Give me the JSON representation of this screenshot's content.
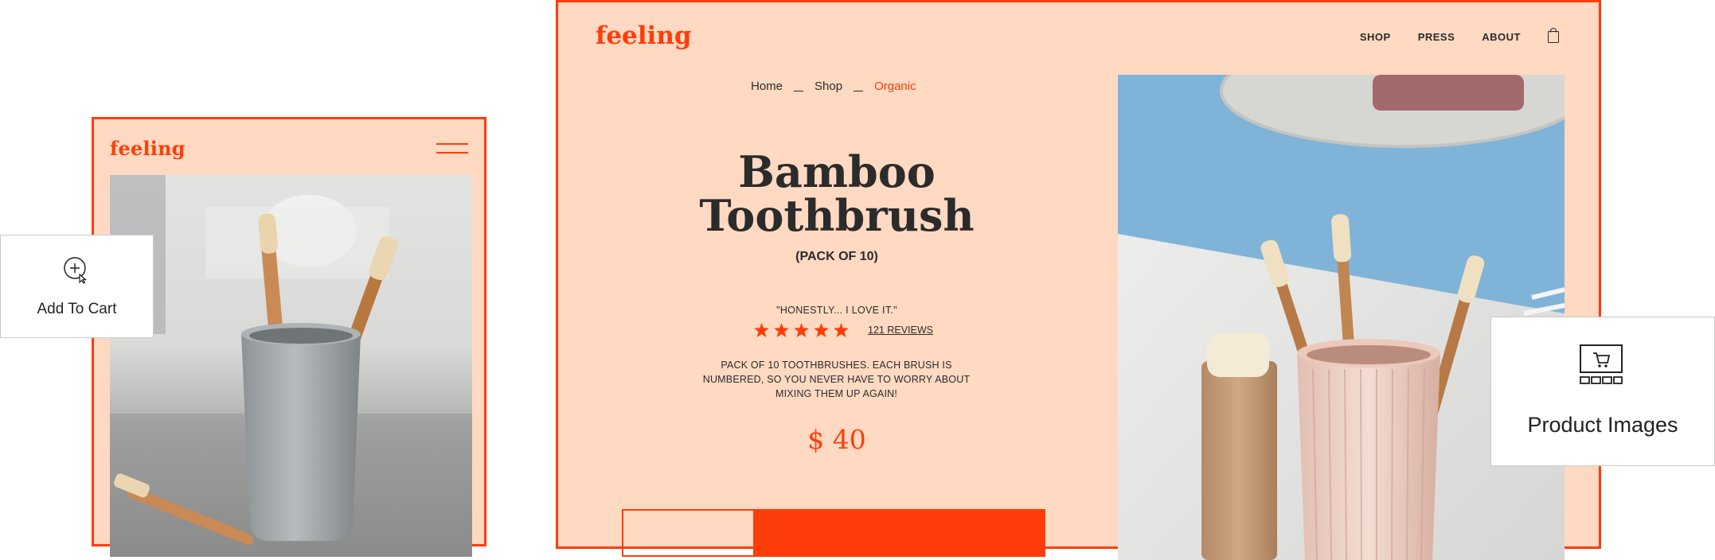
{
  "brand": {
    "name": "feeling",
    "accent": "#ff3d0a",
    "background": "#ffd9c2"
  },
  "mobile": {
    "logo": "feeling",
    "menu_icon": "hamburger-icon",
    "image_alt": "Bamboo toothbrushes in a grey holder"
  },
  "add_to_cart_card": {
    "label": "Add To Cart",
    "icon": "add-to-cart-icon"
  },
  "desktop": {
    "logo": "feeling",
    "nav": [
      {
        "label": "SHOP"
      },
      {
        "label": "PRESS"
      },
      {
        "label": "ABOUT"
      }
    ],
    "cart_icon": "shopping-bag-icon",
    "breadcrumb": [
      "Home",
      "Shop",
      "Organic"
    ],
    "product": {
      "title_line1": "Bamboo",
      "title_line2": "Toothbrush",
      "subtitle": "(PACK OF 10)",
      "quote": "\"HONESTLY... I LOVE IT.\"",
      "rating": 5,
      "reviews": "121 REVIEWS",
      "description": "PACK OF 10 TOOTHBRUSHES. EACH BRUSH IS NUMBERED, SO YOU NEVER HAVE TO WORRY ABOUT MIXING THEM UP AGAIN!",
      "price": "$ 40"
    },
    "image_alt": "Bamboo toothbrushes in a pink ribbed cup"
  },
  "product_images_card": {
    "label": "Product Images",
    "icon": "product-gallery-icon"
  }
}
